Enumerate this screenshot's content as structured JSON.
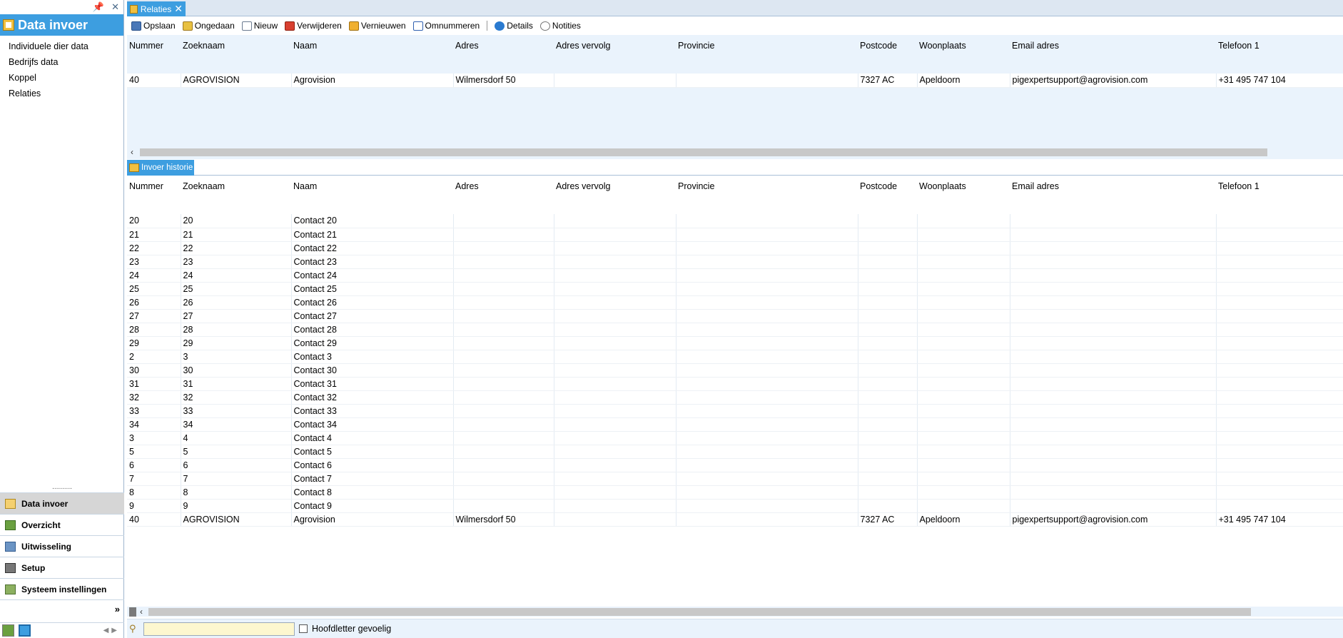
{
  "left_pane": {
    "title": "Data invoer",
    "items": [
      {
        "label": "Individuele dier data"
      },
      {
        "label": "Bedrijfs data"
      },
      {
        "label": "Koppel"
      },
      {
        "label": "Relaties"
      }
    ],
    "splitter_glyph": "..........",
    "modules": [
      {
        "label": "Data invoer",
        "icon": "arrow-folder-icon",
        "active": true
      },
      {
        "label": "Overzicht",
        "icon": "book-icon"
      },
      {
        "label": "Uitwisseling",
        "icon": "exchange-icon"
      },
      {
        "label": "Setup",
        "icon": "setup-icon"
      },
      {
        "label": "Systeem instellingen",
        "icon": "settings-book-icon"
      }
    ],
    "more_glyph": "»"
  },
  "document_tab": {
    "label": "Relaties"
  },
  "toolbar": {
    "save": "Opslaan",
    "undo": "Ongedaan",
    "new": "Nieuw",
    "delete": "Verwijderen",
    "refresh": "Vernieuwen",
    "renumber": "Omnummeren",
    "details": "Details",
    "notes": "Notities"
  },
  "columns": [
    "Nummer",
    "Zoeknaam",
    "Naam",
    "Adres",
    "Adres vervolg",
    "Provincie",
    "Postcode",
    "Woonplaats",
    "Email adres",
    "Telefoon 1"
  ],
  "top_grid": {
    "rows": [
      [
        "40",
        "AGROVISION",
        "Agrovision",
        "Wilmersdorf 50",
        "",
        "",
        "7327 AC",
        "Apeldoorn",
        "pigexpertsupport@agrovision.com",
        "+31 495 747 104"
      ]
    ]
  },
  "history_tab": {
    "label": "Invoer historie"
  },
  "history_grid": {
    "rows": [
      [
        "20",
        "20",
        "Contact 20",
        "",
        "",
        "",
        "",
        "",
        "",
        ""
      ],
      [
        "21",
        "21",
        "Contact 21",
        "",
        "",
        "",
        "",
        "",
        "",
        ""
      ],
      [
        "22",
        "22",
        "Contact 22",
        "",
        "",
        "",
        "",
        "",
        "",
        ""
      ],
      [
        "23",
        "23",
        "Contact 23",
        "",
        "",
        "",
        "",
        "",
        "",
        ""
      ],
      [
        "24",
        "24",
        "Contact 24",
        "",
        "",
        "",
        "",
        "",
        "",
        ""
      ],
      [
        "25",
        "25",
        "Contact 25",
        "",
        "",
        "",
        "",
        "",
        "",
        ""
      ],
      [
        "26",
        "26",
        "Contact 26",
        "",
        "",
        "",
        "",
        "",
        "",
        ""
      ],
      [
        "27",
        "27",
        "Contact 27",
        "",
        "",
        "",
        "",
        "",
        "",
        ""
      ],
      [
        "28",
        "28",
        "Contact 28",
        "",
        "",
        "",
        "",
        "",
        "",
        ""
      ],
      [
        "29",
        "29",
        "Contact 29",
        "",
        "",
        "",
        "",
        "",
        "",
        ""
      ],
      [
        "2",
        "3",
        "Contact 3",
        "",
        "",
        "",
        "",
        "",
        "",
        ""
      ],
      [
        "30",
        "30",
        "Contact 30",
        "",
        "",
        "",
        "",
        "",
        "",
        ""
      ],
      [
        "31",
        "31",
        "Contact 31",
        "",
        "",
        "",
        "",
        "",
        "",
        ""
      ],
      [
        "32",
        "32",
        "Contact 32",
        "",
        "",
        "",
        "",
        "",
        "",
        ""
      ],
      [
        "33",
        "33",
        "Contact 33",
        "",
        "",
        "",
        "",
        "",
        "",
        ""
      ],
      [
        "34",
        "34",
        "Contact 34",
        "",
        "",
        "",
        "",
        "",
        "",
        ""
      ],
      [
        "3",
        "4",
        "Contact 4",
        "",
        "",
        "",
        "",
        "",
        "",
        ""
      ],
      [
        "5",
        "5",
        "Contact 5",
        "",
        "",
        "",
        "",
        "",
        "",
        ""
      ],
      [
        "6",
        "6",
        "Contact 6",
        "",
        "",
        "",
        "",
        "",
        "",
        ""
      ],
      [
        "7",
        "7",
        "Contact 7",
        "",
        "",
        "",
        "",
        "",
        "",
        ""
      ],
      [
        "8",
        "8",
        "Contact 8",
        "",
        "",
        "",
        "",
        "",
        "",
        ""
      ],
      [
        "9",
        "9",
        "Contact 9",
        "",
        "",
        "",
        "",
        "",
        "",
        ""
      ],
      [
        "40",
        "AGROVISION",
        "Agrovision",
        "Wilmersdorf 50",
        "",
        "",
        "7327 AC",
        "Apeldoorn",
        "pigexpertsupport@agrovision.com",
        "+31 495 747 104"
      ]
    ]
  },
  "find_bar": {
    "value": "",
    "case_sensitive_label": "Hoofdletter gevoelig"
  },
  "colors": {
    "accent": "#3d9ee0",
    "grid_header_bg": "#eaf3fc",
    "find_input_bg": "#fdf7cf"
  }
}
